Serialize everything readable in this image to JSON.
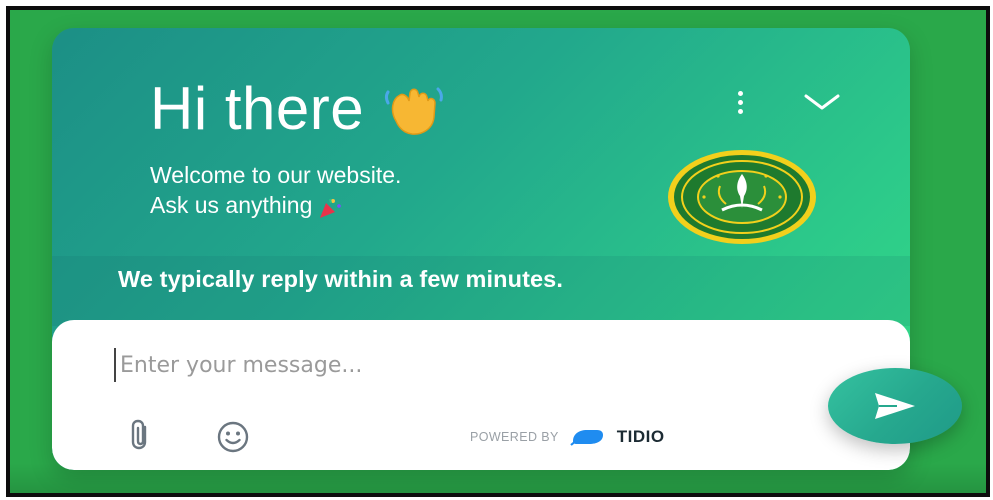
{
  "header": {
    "greeting": "Hi there",
    "greeting_emoji": "waving-hand-icon",
    "welcome_line1": "Welcome to our website.",
    "welcome_line2": "Ask us anything",
    "welcome_emoji": "party-popper-icon",
    "menu_icon": "more-vertical-icon",
    "collapse_icon": "chevron-down-icon",
    "logo_icon": "organization-logo"
  },
  "status": {
    "reply_time": "We typically reply within a few minutes."
  },
  "composer": {
    "placeholder": "Enter your message...",
    "attach_icon": "paperclip-icon",
    "emoji_icon": "smiley-icon",
    "powered_by": "POWERED BY",
    "brand": "TIDIO",
    "send_icon": "send-icon"
  },
  "colors": {
    "outer_background": "#2aa84a",
    "gradient_start": "#1c8f86",
    "gradient_end": "#35dc86",
    "send_button": "#26a88e",
    "text_on_dark": "#ffffff"
  }
}
